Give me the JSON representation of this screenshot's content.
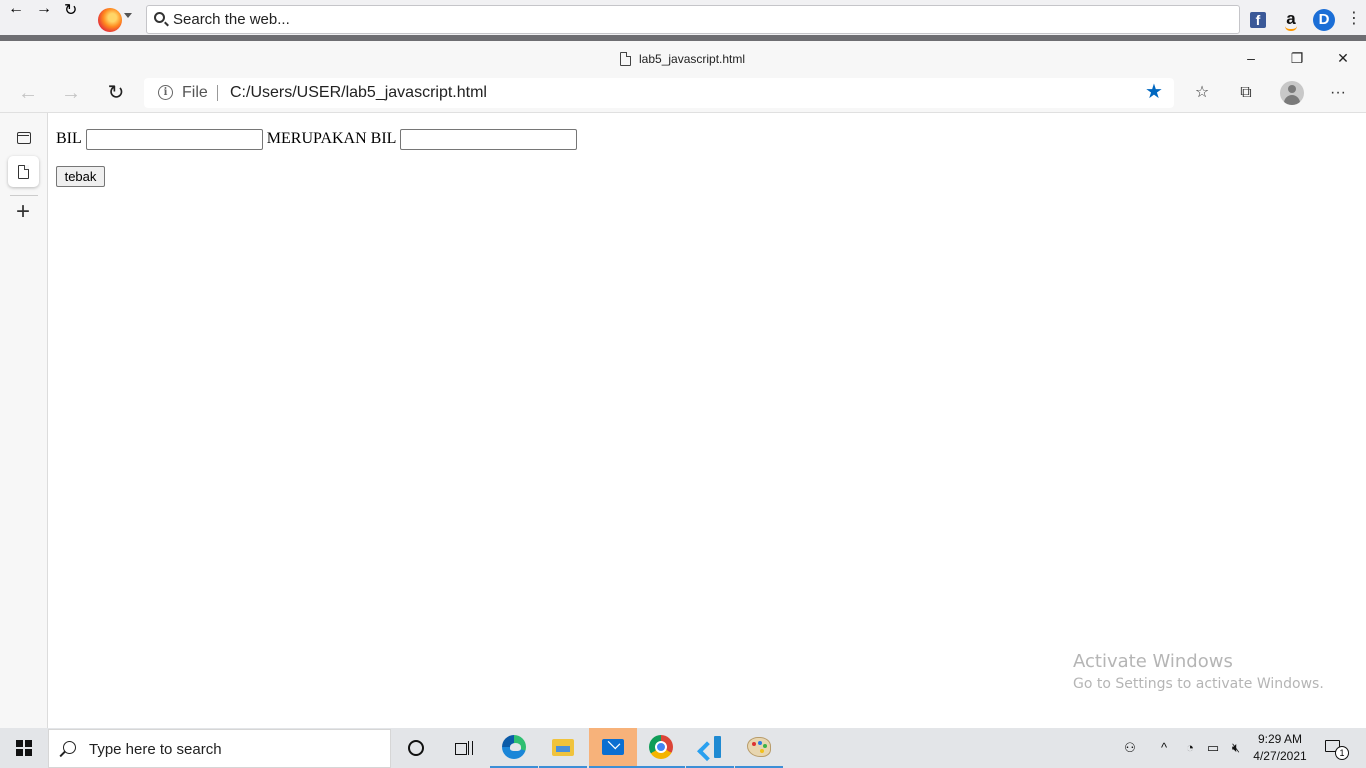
{
  "firefox_toolbar": {
    "search_placeholder": "Search the web...",
    "bookmarks": [
      {
        "icon": "facebook-icon",
        "glyph": "f"
      },
      {
        "icon": "amazon-icon",
        "glyph": "a"
      },
      {
        "icon": "d-extension-icon",
        "glyph": "D"
      }
    ]
  },
  "edge": {
    "tab_title": "lab5_javascript.html",
    "window_controls": {
      "minimize": "–",
      "restore": "❐",
      "close": "✕"
    },
    "address": {
      "scheme_label": "File",
      "url": "C:/Users/USER/lab5_javascript.html"
    },
    "favorite_active": true,
    "accent_color": "#0067c0"
  },
  "page": {
    "label_bil": "BIL",
    "bil_value": "",
    "label_merupakan": "MERUPAKAN BIL",
    "result_value": "",
    "button_label": "tebak"
  },
  "watermark": {
    "title": "Activate Windows",
    "subtitle": "Go to Settings to activate Windows."
  },
  "taskbar": {
    "search_placeholder": "Type here to search",
    "apps": [
      "cortana",
      "task-view",
      "edge",
      "file-explorer",
      "mail",
      "chrome",
      "vscode",
      "paint"
    ],
    "time": "9:29 AM",
    "date": "4/27/2021",
    "notification_count": "1"
  }
}
